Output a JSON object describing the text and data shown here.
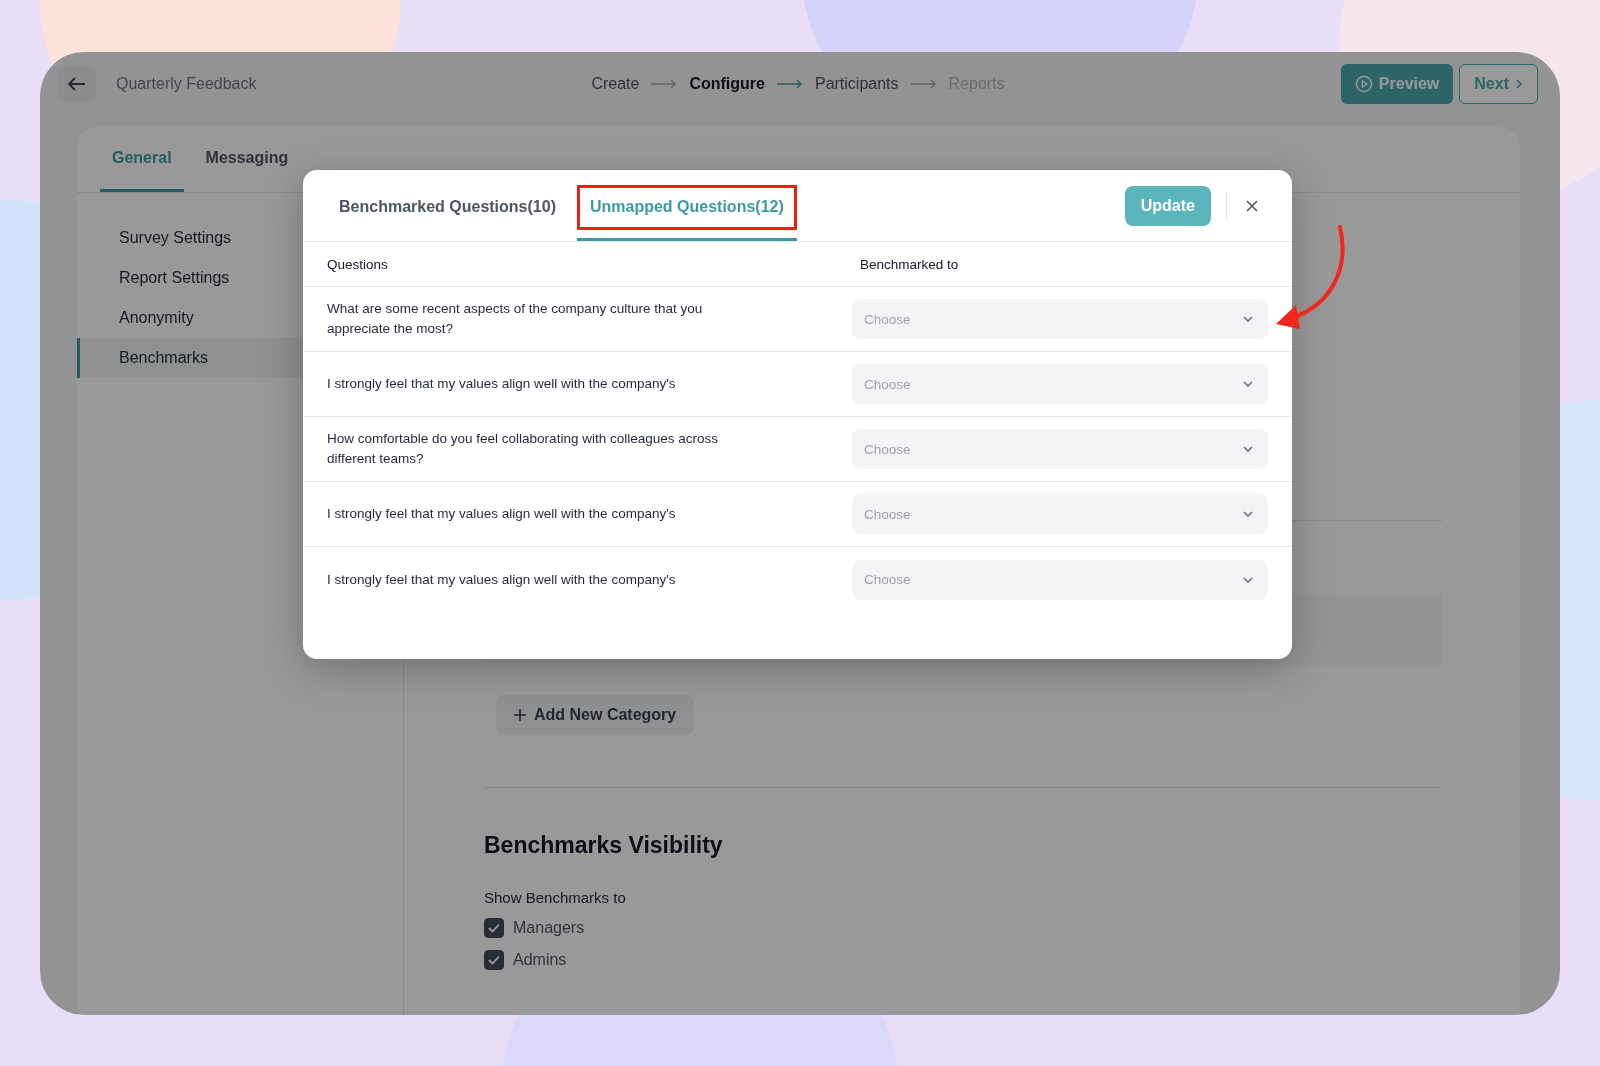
{
  "header": {
    "title": "Quarterly Feedback",
    "steps": [
      {
        "label": "Create",
        "selected": false,
        "disabled": false
      },
      {
        "label": "Configure",
        "selected": true,
        "disabled": false
      },
      {
        "label": "Participants",
        "selected": false,
        "disabled": false
      },
      {
        "label": "Reports",
        "selected": false,
        "disabled": true
      }
    ],
    "buttons": [
      {
        "label": "Preview",
        "kind": "primary"
      },
      {
        "label": "Next",
        "kind": "secondary"
      }
    ]
  },
  "tabs": [
    {
      "label": "General",
      "selected": true
    },
    {
      "label": "Messaging",
      "selected": false
    }
  ],
  "sidebar": {
    "items": [
      {
        "label": "Survey Settings",
        "selected": false
      },
      {
        "label": "Report Settings",
        "selected": false
      },
      {
        "label": "Anonymity",
        "selected": false
      },
      {
        "label": "Benchmarks",
        "selected": true
      }
    ]
  },
  "main": {
    "add_category_button": "Add New Category",
    "visibility": {
      "heading": "Benchmarks Visibility",
      "subtitle": "Show Benchmarks to",
      "options": [
        {
          "label": "Managers",
          "checked": true
        },
        {
          "label": "Admins",
          "checked": true
        }
      ]
    }
  },
  "modal": {
    "tabs": [
      {
        "label": "Benchmarked Questions(10)",
        "selected": false,
        "highlighted": false
      },
      {
        "label": "Unmapped Questions(12)",
        "selected": true,
        "highlighted": true
      }
    ],
    "update_button": "Update",
    "columns": [
      "Questions",
      "Benchmarked to"
    ],
    "rows": [
      {
        "question": "What are some recent aspects of the company culture that you appreciate the most?",
        "placeholder": "Choose"
      },
      {
        "question": "I strongly feel that my values align well with the company's",
        "placeholder": "Choose"
      },
      {
        "question": "How comfortable do you feel collaborating with colleagues across different teams?",
        "placeholder": "Choose"
      },
      {
        "question": "I strongly feel that my values align well with the company's",
        "placeholder": "Choose"
      },
      {
        "question": "I strongly feel that my values align well with the company's",
        "placeholder": "Choose"
      }
    ]
  }
}
